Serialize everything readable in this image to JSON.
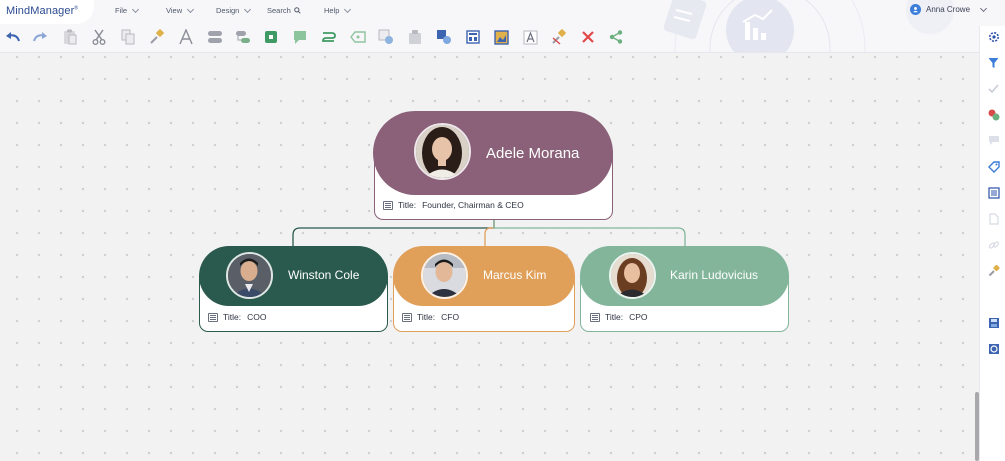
{
  "app": {
    "logo": "MindManager",
    "logo_mark": "®"
  },
  "menu": [
    {
      "label": "File"
    },
    {
      "label": "View"
    },
    {
      "label": "Design"
    },
    {
      "label": "Search"
    },
    {
      "label": "Help"
    }
  ],
  "user": {
    "name": "Anna Crowe"
  },
  "toolbar_icons": [
    "undo-icon",
    "redo-icon",
    "paste-icon",
    "cut-icon",
    "copy-icon",
    "format-painter-icon",
    "text-style-icon",
    "add-topic-icon",
    "add-subtopic-icon",
    "add-floating-topic-icon",
    "add-callout-icon",
    "add-relationship-icon",
    "add-boundary-icon",
    "add-summary-icon",
    "insert-image-icon",
    "attach-icon",
    "insert-shape-icon",
    "layout-icon",
    "picture-icon",
    "text-icon",
    "clear-format-icon",
    "delete-icon",
    "share-icon"
  ],
  "sidebar_icons": [
    "settings-icon",
    "filter-icon",
    "check-icon",
    "markers-icon",
    "comments-icon",
    "tags-icon",
    "notes-icon",
    "document-icon",
    "link-icon",
    "brush-icon",
    "save-icon",
    "focus-icon"
  ],
  "colors": {
    "ceo": "#8a6178",
    "coo": "#2a5a4d",
    "cfo": "#e0a05a",
    "cpo": "#82b59a",
    "connector_coo": "#2a5a4d",
    "connector_cfo": "#e0a05a",
    "connector_cpo": "#82b59a"
  },
  "org_chart": {
    "root": {
      "name": "Adele Morana",
      "title_label": "Title:",
      "title_value": "Founder, Chairman & CEO"
    },
    "children": [
      {
        "name": "Winston Cole",
        "title_label": "Title:",
        "title_value": "COO"
      },
      {
        "name": "Marcus Kim",
        "title_label": "Title:",
        "title_value": "CFO"
      },
      {
        "name": "Karin Ludovicius",
        "title_label": "Title:",
        "title_value": "CPO"
      }
    ]
  }
}
